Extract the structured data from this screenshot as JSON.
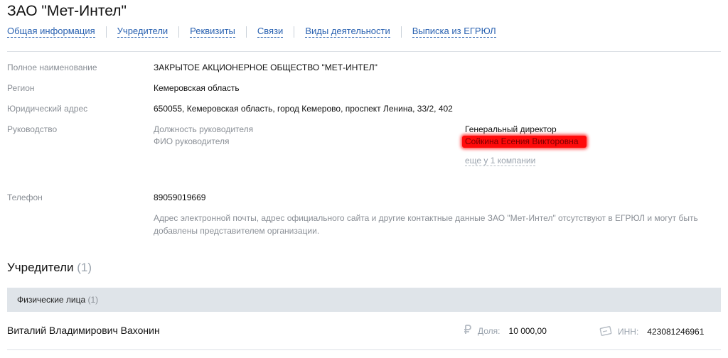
{
  "company": {
    "title": "ЗАО \"Мет-Интел\""
  },
  "nav": [
    "Общая информация",
    "Учредители",
    "Реквизиты",
    "Связи",
    "Виды деятельности",
    "Выписка из ЕГРЮЛ"
  ],
  "details": {
    "full_name_label": "Полное наименование",
    "full_name": "ЗАКРЫТОЕ АКЦИОНЕРНОЕ ОБЩЕСТВО \"МЕТ-ИНТЕЛ\"",
    "region_label": "Регион",
    "region": "Кемеровская область",
    "address_label": "Юридический адрес",
    "address": "650055, Кемеровская область, город Кемерово, проспект Ленина, 33/2, 402"
  },
  "management": {
    "label": "Руководство",
    "position_label": "Должность руководителя",
    "name_label": "ФИО руководителя",
    "position": "Генеральный директор",
    "name": "Сойкина Есения Викторовна",
    "more": "еще у 1 компании"
  },
  "contacts": {
    "phone_label": "Телефон",
    "phone": "89059019669",
    "hint": "Адрес электронной почты, адрес официального сайта и другие контактные данные ЗАО \"Мет-Интел\" отсутствуют в ЕГРЮЛ и могут быть добавлены представителем организации."
  },
  "founders": {
    "title": "Учредители",
    "count": "(1)",
    "group_label": "Физические лица",
    "group_count": "(1)",
    "items": [
      {
        "name": "Виталий Владимирович Вахонин",
        "share_label": "Доля:",
        "share": "10 000,00",
        "inn_label": "ИНН:",
        "inn": "423081246961"
      }
    ]
  },
  "colors": {
    "link": "#2a62b1",
    "muted": "#8a8f96",
    "redaction": "#ff0a0a",
    "subheader_bg": "#dfe4e9"
  },
  "icons": {
    "share": "ruble-icon",
    "inn": "id-card-icon"
  }
}
